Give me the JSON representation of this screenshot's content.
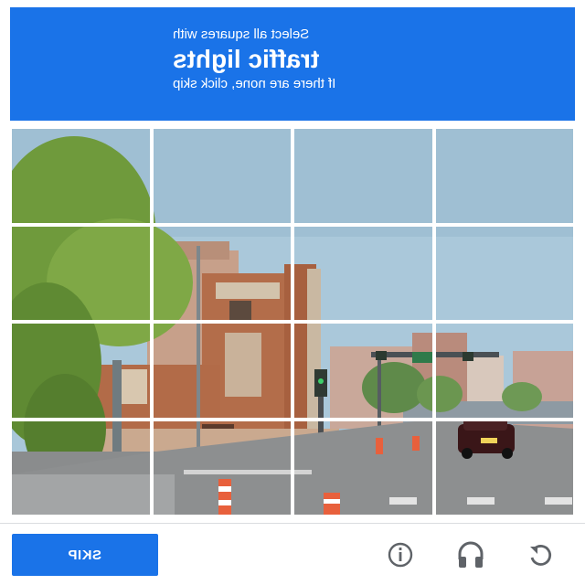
{
  "header": {
    "prompt_line": "Select all squares with",
    "target_object": "traffic lights",
    "skip_hint": "If there are none, click skip"
  },
  "grid": {
    "rows": 4,
    "columns": 4
  },
  "footer": {
    "skip_label": "SKIP",
    "icons": [
      "info-icon",
      "headphones-icon",
      "reload-icon"
    ]
  },
  "colors": {
    "accent": "#1a73e8",
    "icon_gray": "#5f6368",
    "divider": "#dadce0"
  }
}
